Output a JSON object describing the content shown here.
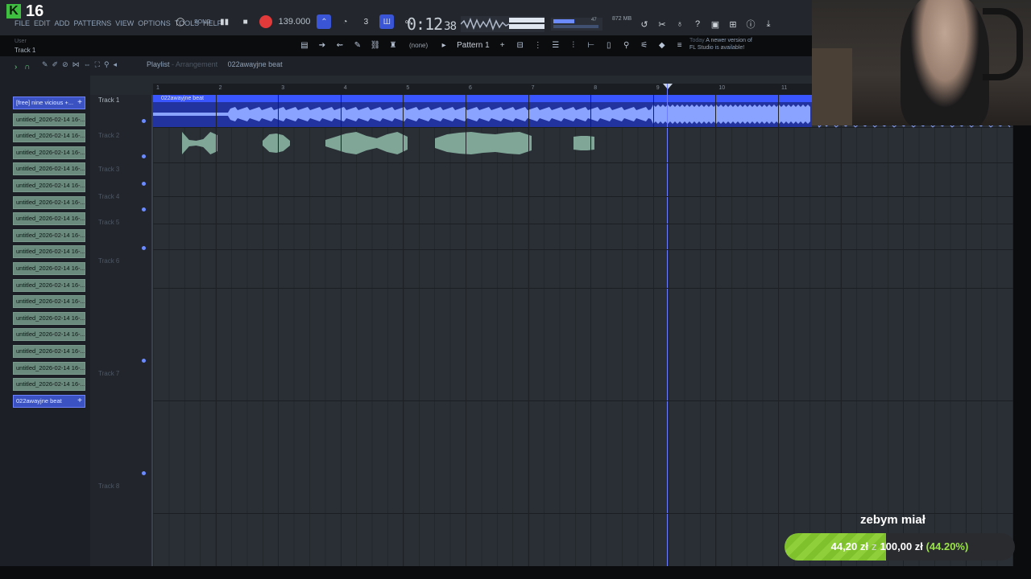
{
  "app": {
    "version": "16",
    "logo": "K"
  },
  "menu": [
    "FILE",
    "EDIT",
    "ADD",
    "PATTERNS",
    "VIEW",
    "OPTIONS",
    "TOOLS",
    "HELP"
  ],
  "user_label": "User",
  "track_hint": "Track 1",
  "transport": {
    "mode": "SONG",
    "tempo": "139.000",
    "time": "0:12",
    "time_sub": "38"
  },
  "memory": "872 MB",
  "meter_value": "47",
  "pattern": {
    "none_label": "(none)",
    "selected": "Pattern 1"
  },
  "news": {
    "today": "Today",
    "line1": "A newer version of",
    "line2": "FL Studio is available!"
  },
  "playlist": {
    "title": "Playlist",
    "subtitle": "Arrangement",
    "song": "022awayjne beat",
    "timeline_numbers": [
      "1",
      "2",
      "3",
      "4",
      "5",
      "6",
      "7",
      "8",
      "9",
      "10",
      "11"
    ]
  },
  "tracks": [
    {
      "label": "Track 1",
      "active": true
    },
    {
      "label": "Track 2",
      "active": false
    },
    {
      "label": "Track 3",
      "active": false
    },
    {
      "label": "Track 4",
      "active": false
    },
    {
      "label": "Track 5",
      "active": false
    },
    {
      "label": "Track 6",
      "active": false
    },
    {
      "label": "Track 7",
      "active": false
    },
    {
      "label": "Track 8",
      "active": false
    }
  ],
  "clips": [
    "[free] nine vicious +...",
    "untitled_2026-02-14 16-...",
    "untitled_2026-02-14 16-...",
    "untitled_2026-02-14 16-...",
    "untitled_2026-02-14 16-...",
    "untitled_2026-02-14 16-...",
    "untitled_2026-02-14 16-...",
    "untitled_2026-02-14 16-...",
    "untitled_2026-02-14 16-...",
    "untitled_2026-02-14 16-...",
    "untitled_2026-02-14 16-...",
    "untitled_2026-02-14 16-...",
    "untitled_2026-02-14 16-...",
    "untitled_2026-02-14 16-...",
    "untitled_2026-02-14 16-...",
    "untitled_2026-02-14 16-...",
    "untitled_2026-02-14 16-...",
    "untitled_2026-02-14 16-...",
    "022awayjne beat"
  ],
  "audio_clip_name": "022awayjne beat",
  "donation": {
    "label": "zebym miał",
    "current": "44,20 zł",
    "separator": "z",
    "goal": "100,00 zł",
    "percent_text": "(44.20%)",
    "progress": 0.442
  },
  "colors": {
    "accent": "#3a57ff",
    "clip_green": "#6a8a7e",
    "donate_green": "#8fcf3a",
    "record": "#e23a3a"
  }
}
